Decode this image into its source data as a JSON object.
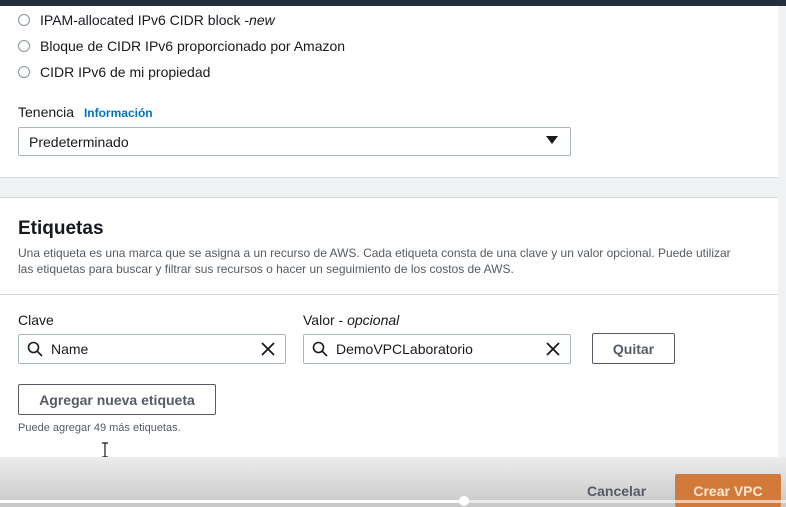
{
  "ipv6_options": [
    {
      "label": "IPAM-allocated IPv6 CIDR block - ",
      "suffix": "new"
    },
    {
      "label": "Bloque de CIDR IPv6 proporcionado por Amazon"
    },
    {
      "label": "CIDR IPv6 de mi propiedad"
    }
  ],
  "tenancy": {
    "label": "Tenencia",
    "info_link": "Información",
    "selected": "Predeterminado"
  },
  "tags": {
    "title": "Etiquetas",
    "description": "Una etiqueta es una marca que se asigna a un recurso de AWS. Cada etiqueta consta de una clave y un valor opcional. Puede utilizar las etiquetas para buscar y filtrar sus recursos o hacer un seguimiento de los costos de AWS.",
    "key_label": "Clave",
    "value_label": "Valor - ",
    "value_optional": "opcional",
    "key_value": "Name",
    "value_value": "DemoVPCLaboratorio",
    "remove_button": "Quitar",
    "add_button": "Agregar nueva etiqueta",
    "remaining_text": "Puede agregar 49 más etiquetas."
  },
  "footer": {
    "cancel_button": "Cancelar",
    "create_button": "Crear VPC"
  },
  "video_progress": 0.59,
  "colors": {
    "accent": "#d17a3a",
    "link": "#0073bb",
    "topbar": "#232f3e"
  }
}
